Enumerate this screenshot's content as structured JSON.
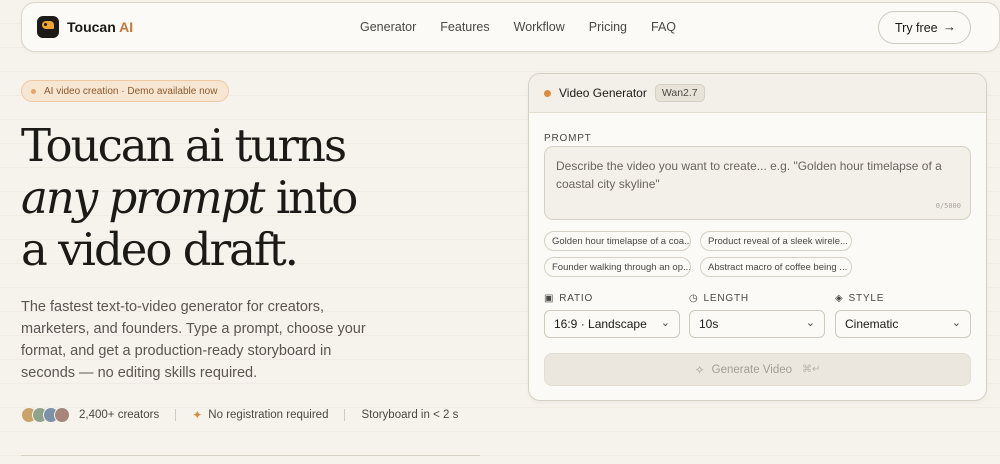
{
  "nav": {
    "brand": "Toucan",
    "brand_accent": "AI",
    "links": [
      "Generator",
      "Features",
      "Workflow",
      "Pricing",
      "FAQ"
    ],
    "cta_label": "Try free",
    "cta_icon": "arrow-right-icon"
  },
  "hero": {
    "badge": "AI video creation · Demo available now",
    "title_line1": "Toucan ai turns",
    "title_italic": "any prompt",
    "title_line2_rest": "into",
    "title_line3": "a video draft.",
    "subtitle": "The fastest text-to-video generator for creators, marketers, and founders. Type a prompt, choose your format, and get a production-ready storyboard in seconds — no editing skills required.",
    "creators": "2,400+ creators",
    "no_registration": "No registration required",
    "storyboard": "Storyboard in < 2 s",
    "avatar_colors": [
      "#c9a36a",
      "#8fa38a",
      "#7b93a8",
      "#a6867a"
    ]
  },
  "generator": {
    "title": "Video Generator",
    "model": "Wan2.7",
    "prompt_label": "PROMPT",
    "prompt_placeholder": "Describe the video you want to create... e.g. \"Golden hour timelapse of a coastal city skyline\"",
    "char_count": "0/5000",
    "suggestions": [
      "Golden hour timelapse of a coa...",
      "Product reveal of a sleek wirele...",
      "Founder walking through an op...",
      "Abstract macro of coffee being ..."
    ],
    "ratio_label": "RATIO",
    "ratio_value": "16:9 · Landscape",
    "length_label": "LENGTH",
    "length_value": "10s",
    "style_label": "STYLE",
    "style_value": "Cinematic",
    "generate_label": "Generate Video"
  },
  "colors": {
    "accent": "#c2783a",
    "background": "#f6f3ec",
    "live_dot": "#e08a3c"
  }
}
